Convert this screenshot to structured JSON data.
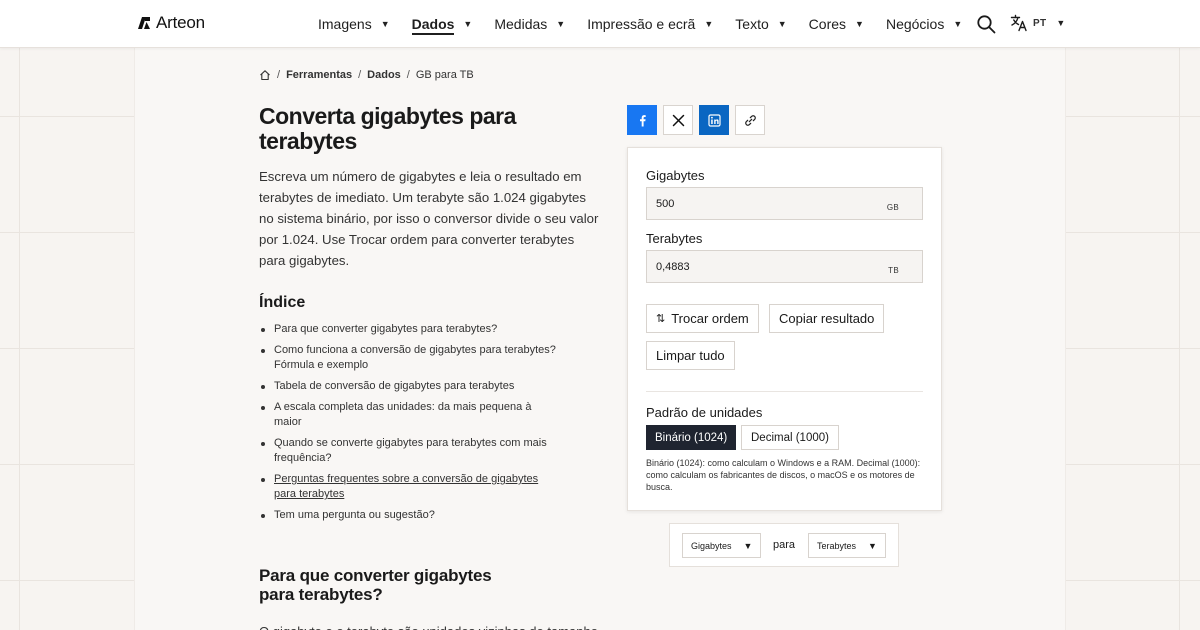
{
  "app": {
    "brand": "Arteon"
  },
  "nav": {
    "items": [
      {
        "label": "Imagens",
        "active": false
      },
      {
        "label": "Dados",
        "active": true
      },
      {
        "label": "Medidas",
        "active": false
      },
      {
        "label": "Impressão e ecrã",
        "active": false
      },
      {
        "label": "Texto",
        "active": false
      },
      {
        "label": "Cores",
        "active": false
      },
      {
        "label": "Negócios",
        "active": false
      }
    ],
    "caret": "▼"
  },
  "header": {
    "search_icon": "search-icon",
    "language_icon": "translate-icon",
    "language_code": "PT"
  },
  "breadcrumb": {
    "home_icon": "home-icon",
    "separator": "/",
    "items": [
      "Ferramentas",
      "Dados"
    ],
    "current": "GB para TB"
  },
  "page": {
    "title": "Converta gigabytes para terabytes",
    "intro": "Escreva um número de gigabytes e leia o resultado em terabytes de imediato. Um terabyte são 1.024 gigabytes no sistema binário, por isso o conversor divide o seu valor por 1.024. Use Trocar ordem para converter terabytes para gigabytes.",
    "toc_title": "Índice",
    "toc": [
      "Para que converter gigabytes para terabytes?",
      "Como funciona a conversão de gigabytes para terabytes? Fórmula e exemplo",
      "Tabela de conversão de gigabytes para terabytes",
      "A escala completa das unidades: da mais pequena à maior",
      "Quando se converte gigabytes para terabytes com mais frequência?",
      "Perguntas frequentes sobre a conversão de gigabytes para terabytes",
      "Tem uma pergunta ou sugestão?"
    ],
    "section_title": "Para que converter gigabytes para terabytes?",
    "section_body": "O gigabyte e o terabyte são unidades vizinhas de tamanho"
  },
  "share": {
    "buttons": [
      {
        "icon": "facebook-icon",
        "color": "#1877f2"
      },
      {
        "icon": "x-icon",
        "color": "#ffffff"
      },
      {
        "icon": "linkedin-icon",
        "color": "#0a66c2"
      },
      {
        "icon": "link-icon",
        "color": "#ffffff"
      }
    ]
  },
  "converter": {
    "from_label": "Gigabytes",
    "from_value": "500",
    "from_unit": "GB",
    "to_label": "Terabytes",
    "to_value": "0,4883",
    "to_unit": "TB",
    "swap_label": "Trocar ordem",
    "copy_label": "Copiar resultado",
    "clear_label": "Limpar tudo",
    "standard_label": "Padrão de unidades",
    "binary_label": "Binário (1024)",
    "decimal_label": "Decimal (1000)",
    "selected_standard": "Binário (1024)",
    "note": "Binário (1024): como calculam o Windows e a RAM. Decimal (1000): como calculam os fabricantes de discos, o macOS e os motores de busca."
  },
  "unit_selector": {
    "from": "Gigabytes",
    "connector": "para",
    "to": "Terabytes"
  },
  "colors": {
    "accent_dark": "#1f2430",
    "facebook": "#1877f2",
    "linkedin": "#0a66c2"
  }
}
